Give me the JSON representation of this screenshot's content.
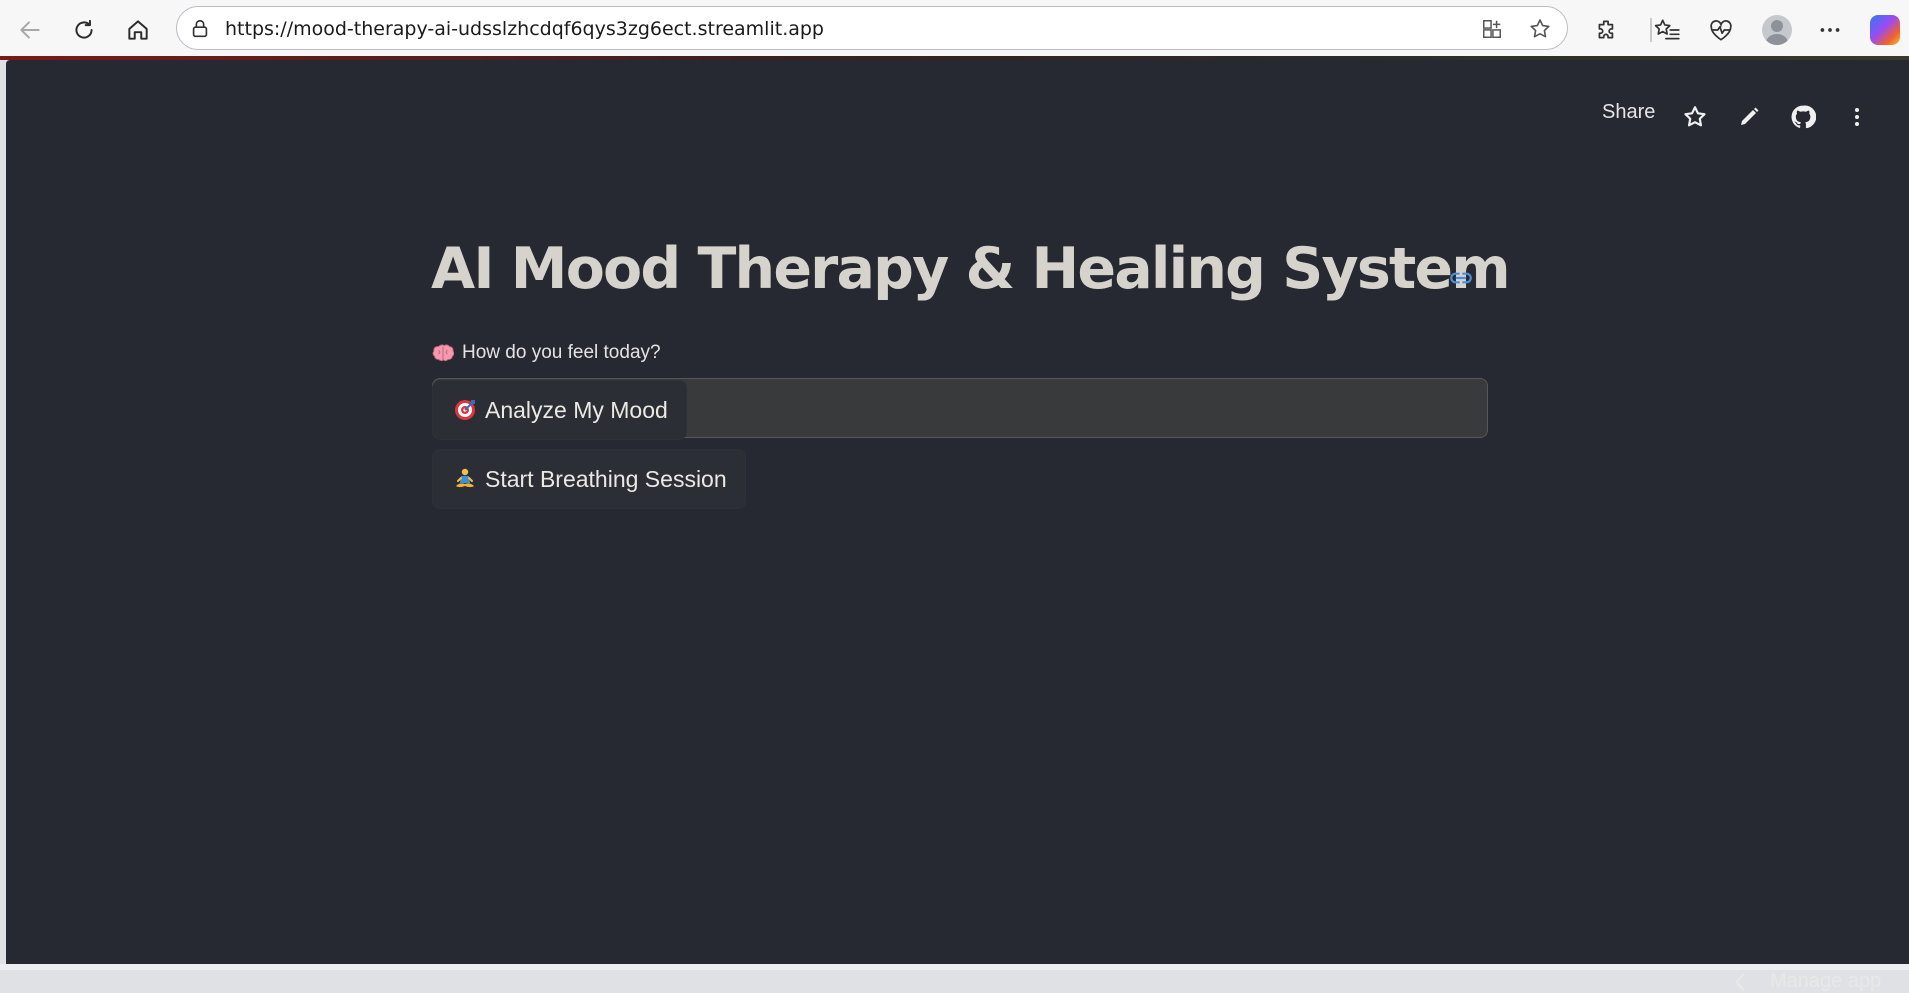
{
  "browser": {
    "url": "https://mood-therapy-ai-udsslzhcdqf6qys3zg6ect.streamlit.app"
  },
  "app_toolbar": {
    "share_label": "Share"
  },
  "main": {
    "title": "AI Mood Therapy & Healing System",
    "mood_prompt": {
      "label": "How do you feel today?",
      "value": "",
      "placeholder": ""
    },
    "analyze_button": {
      "label": "Analyze My Mood"
    },
    "breathing_button": {
      "label": "Start Breathing Session"
    }
  },
  "footer": {
    "manage_app_label": "Manage app"
  },
  "icons": {
    "label_emoji": "brain-icon",
    "analyze_emoji": "target-icon",
    "breathing_emoji": "person-meditating-icon"
  },
  "colors": {
    "app_background": "#262931",
    "title_text": "#d6d3cc",
    "input_background": "#393a3c",
    "anchor_link": "#4b8ed8"
  }
}
